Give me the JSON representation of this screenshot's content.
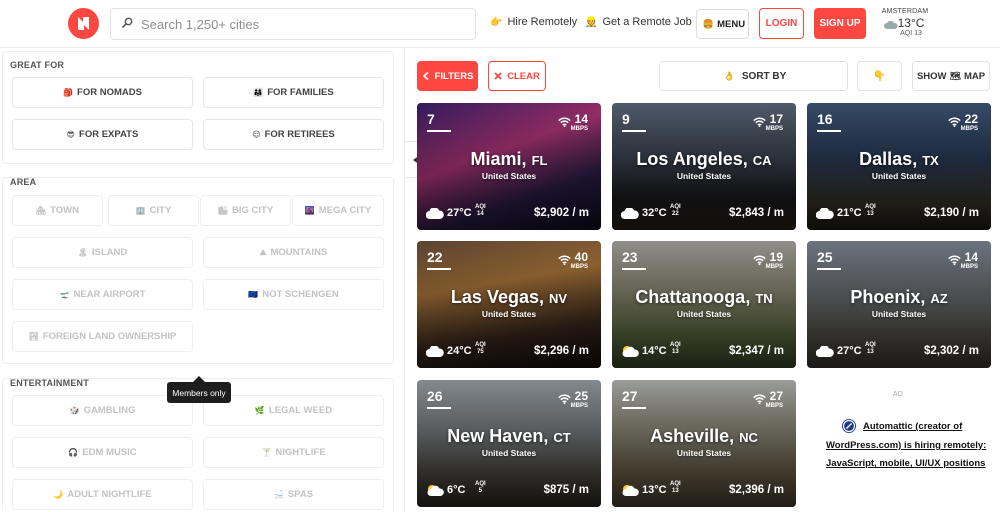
{
  "header": {
    "search_placeholder": "Search 1,250+ cities",
    "hire_label": "Hire Remotely",
    "job_label": "Get a Remote Job",
    "menu_label": "MENU",
    "login_label": "LOGIN",
    "signup_label": "SIGN UP",
    "weather": {
      "city": "AMSTERDAM",
      "temp": "13°C",
      "aqi": "AQI 13"
    }
  },
  "sidebar": {
    "great_for": {
      "title": "GREAT FOR",
      "items": [
        "FOR NOMADS",
        "FOR FAMILIES",
        "FOR EXPATS",
        "FOR RETIREES"
      ]
    },
    "area": {
      "title": "AREA",
      "items": [
        "TOWN",
        "CITY",
        "BIG CITY",
        "MEGA CITY",
        "ISLAND",
        "MOUNTAINS",
        "NEAR AIRPORT",
        "NOT SCHENGEN",
        "FOREIGN LAND OWNERSHIP"
      ]
    },
    "entertainment": {
      "title": "ENTERTAINMENT",
      "items": [
        "GAMBLING",
        "LEGAL WEED",
        "EDM MUSIC",
        "NIGHTLIFE",
        "ADULT NIGHTLIFE",
        "SPAS"
      ]
    },
    "tooltip": "Members only"
  },
  "toolbar": {
    "filters_label": "FILTERS",
    "clear_label": "CLEAR",
    "sort_label": "SORT BY",
    "map_label": "MAP",
    "show_label": "SHOW"
  },
  "cities": [
    {
      "rank": "7",
      "name": "Miami",
      "state": "FL",
      "country": "United States",
      "mbps": "14",
      "temp": "27°C",
      "aqi": "14",
      "cost": "$2,902 / m",
      "weather": "cloud"
    },
    {
      "rank": "9",
      "name": "Los Angeles",
      "state": "CA",
      "country": "United States",
      "mbps": "17",
      "temp": "32°C",
      "aqi": "22",
      "cost": "$2,843 / m",
      "weather": "cloud"
    },
    {
      "rank": "16",
      "name": "Dallas",
      "state": "TX",
      "country": "United States",
      "mbps": "22",
      "temp": "21°C",
      "aqi": "13",
      "cost": "$2,190 / m",
      "weather": "cloud"
    },
    {
      "rank": "22",
      "name": "Las Vegas",
      "state": "NV",
      "country": "United States",
      "mbps": "40",
      "temp": "24°C",
      "aqi": "75",
      "cost": "$2,296 / m",
      "weather": "cloud"
    },
    {
      "rank": "23",
      "name": "Chattanooga",
      "state": "TN",
      "country": "United States",
      "mbps": "19",
      "temp": "14°C",
      "aqi": "13",
      "cost": "$2,347 / m",
      "weather": "sun-cloud"
    },
    {
      "rank": "25",
      "name": "Phoenix",
      "state": "AZ",
      "country": "United States",
      "mbps": "14",
      "temp": "27°C",
      "aqi": "13",
      "cost": "$2,302 / m",
      "weather": "cloud"
    },
    {
      "rank": "26",
      "name": "New Haven",
      "state": "CT",
      "country": "United States",
      "mbps": "25",
      "temp": "6°C",
      "aqi": "5",
      "cost": "$875 / m",
      "weather": "sun-cloud"
    },
    {
      "rank": "27",
      "name": "Asheville",
      "state": "NC",
      "country": "United States",
      "mbps": "27",
      "temp": "13°C",
      "aqi": "13",
      "cost": "$2,396 / m",
      "weather": "sun-cloud"
    }
  ],
  "ad": {
    "label": "AD",
    "line1": "Automattic (creator of",
    "line2": "WordPress.com) is hiring remotely:",
    "line3": "JavaScript, mobile, UI/UX positions"
  },
  "labels": {
    "mbps": "MBPS",
    "aqi": "AQI"
  },
  "colors": {
    "accent": "#ff4742",
    "text": "#222222"
  }
}
